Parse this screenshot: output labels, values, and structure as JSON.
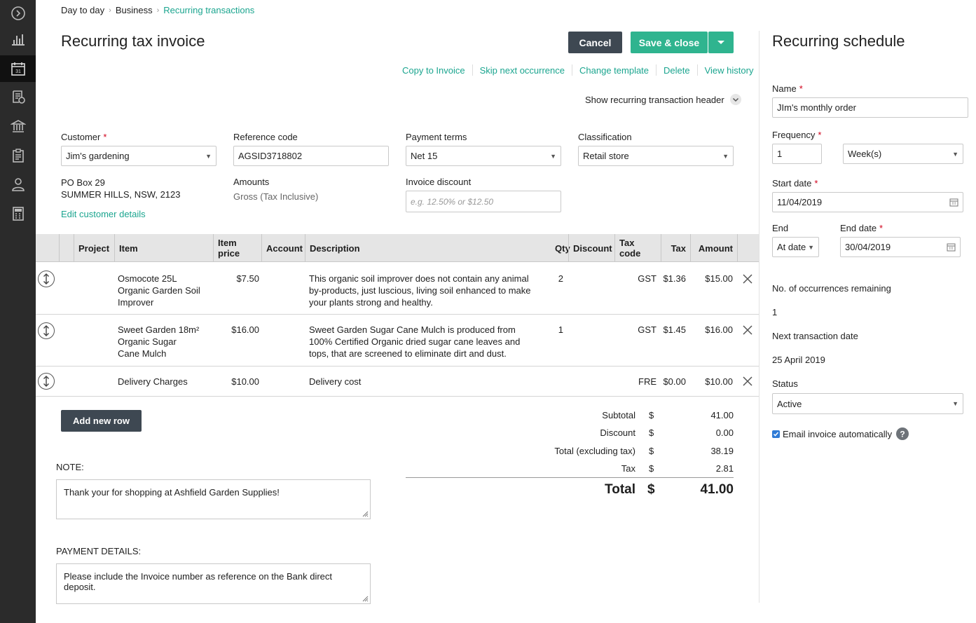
{
  "breadcrumbs": [
    "Day to day",
    "Business",
    "Recurring transactions"
  ],
  "page_title": "Recurring tax invoice",
  "buttons": {
    "cancel": "Cancel",
    "save_close": "Save & close",
    "add_row": "Add new row"
  },
  "actions": [
    "Copy to Invoice",
    "Skip next occurrence",
    "Change template",
    "Delete",
    "View history"
  ],
  "show_header_label": "Show recurring transaction header",
  "form": {
    "customer_label": "Customer",
    "customer_value": "Jim's gardening",
    "address_line1": "PO Box 29",
    "address_line2": "SUMMER HILLS, NSW, 2123",
    "edit_customer": "Edit customer details",
    "reference_label": "Reference code",
    "reference_value": "AGSID3718802",
    "amounts_label": "Amounts",
    "amounts_value": "Gross (Tax Inclusive)",
    "payment_terms_label": "Payment terms",
    "payment_terms_value": "Net 15",
    "invoice_discount_label": "Invoice discount",
    "invoice_discount_placeholder": "e.g. 12.50% or $12.50",
    "classification_label": "Classification",
    "classification_value": "Retail store"
  },
  "table": {
    "headers": [
      "Project",
      "Item",
      "Item price",
      "Account",
      "Description",
      "Qty",
      "Discount",
      "Tax code",
      "Tax",
      "Amount"
    ],
    "rows": [
      {
        "item": "Osmocote 25L Organic Garden Soil Improver",
        "price": "$7.50",
        "description": "This organic soil improver does not contain any animal by-products, just luscious, living soil enhanced to make your plants strong and healthy.",
        "qty": "2",
        "tax_code": "GST",
        "tax": "$1.36",
        "amount": "$15.00"
      },
      {
        "item": "Sweet Garden 18m² Organic Sugar Cane Mulch",
        "price": "$16.00",
        "description": "Sweet Garden Sugar Cane Mulch is produced from 100% Certified Organic dried sugar cane leaves and tops, that are screened to eliminate dirt and dust.",
        "qty": "1",
        "tax_code": "GST",
        "tax": "$1.45",
        "amount": "$16.00"
      },
      {
        "item": "Delivery Charges",
        "price": "$10.00",
        "description": "Delivery cost",
        "qty": "",
        "tax_code": "FRE",
        "tax": "$0.00",
        "amount": "$10.00"
      }
    ]
  },
  "totals": {
    "subtotal_label": "Subtotal",
    "subtotal": "41.00",
    "discount_label": "Discount",
    "discount": "0.00",
    "excl_label": "Total (excluding tax)",
    "excl": "38.19",
    "tax_label": "Tax",
    "tax": "2.81",
    "total_label": "Total",
    "total": "41.00",
    "currency": "$"
  },
  "note": {
    "label": "NOTE:",
    "value": "Thank your for shopping at Ashfield Garden Supplies!"
  },
  "payment": {
    "label": "PAYMENT DETAILS:",
    "value": "Please include the Invoice number as reference on the Bank direct deposit."
  },
  "schedule": {
    "title": "Recurring schedule",
    "name_label": "Name",
    "name_value": "JIm's monthly order",
    "frequency_label": "Frequency",
    "frequency_value": "1",
    "frequency_unit": "Week(s)",
    "start_label": "Start date",
    "start_value": "11/04/2019",
    "end_label": "End",
    "end_value": "At date",
    "end_date_label": "End date",
    "end_date_value": "30/04/2019",
    "occurrences_label": "No. of occurrences remaining",
    "occurrences_value": "1",
    "next_label": "Next transaction date",
    "next_value": "25 April 2019",
    "status_label": "Status",
    "status_value": "Active",
    "email_label": "Email invoice automatically",
    "email_checked": true
  },
  "colors": {
    "accent": "#1ba58f",
    "green_button": "#2fb48f",
    "dark_button": "#3e4852",
    "rail": "#2b2b2b"
  },
  "icons": [
    "expand-icon",
    "chart-icon",
    "calendar-icon",
    "invoice-icon",
    "bank-icon",
    "clipboard-icon",
    "contacts-icon",
    "calculator-icon",
    "drag-handle-icon",
    "remove-icon",
    "help-icon",
    "calendar-picker-icon"
  ]
}
